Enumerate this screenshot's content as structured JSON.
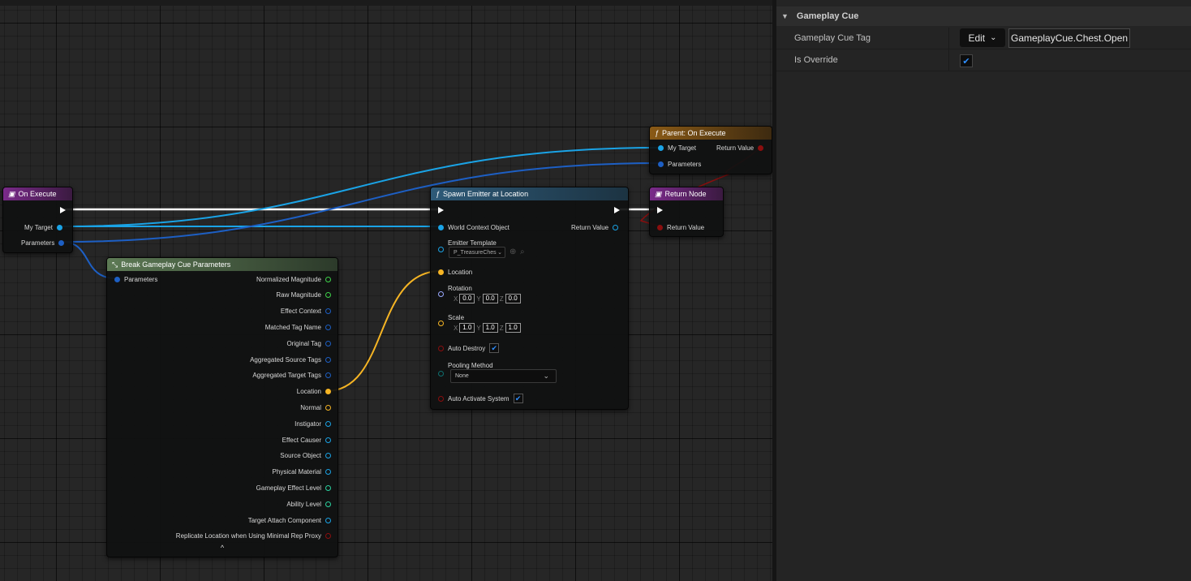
{
  "graph": {
    "nodes": {
      "on_execute": {
        "title": "On Execute",
        "pins": {
          "my_target": "My Target",
          "parameters": "Parameters"
        }
      },
      "parent_on_execute": {
        "title": "Parent: On Execute",
        "pins": {
          "my_target": "My Target",
          "parameters": "Parameters",
          "return_value": "Return Value"
        }
      },
      "spawn_emitter": {
        "title": "Spawn Emitter at Location",
        "pins": {
          "world_context": "World Context Object",
          "return_value": "Return Value",
          "emitter_template": "Emitter Template",
          "emitter_value": "P_TreasureChes",
          "location": "Location",
          "rotation": "Rotation",
          "rotation_x": "0.0",
          "rotation_y": "0.0",
          "rotation_z": "0.0",
          "scale": "Scale",
          "scale_x": "1.0",
          "scale_y": "1.0",
          "scale_z": "1.0",
          "auto_destroy": "Auto Destroy",
          "pooling_method": "Pooling Method",
          "pooling_value": "None",
          "auto_activate": "Auto Activate System",
          "axis_x": "X",
          "axis_y": "Y",
          "axis_z": "Z"
        }
      },
      "return_node": {
        "title": "Return Node",
        "pins": {
          "return_value": "Return Value"
        }
      },
      "break_params": {
        "title": "Break Gameplay Cue Parameters",
        "input": "Parameters",
        "outputs": [
          {
            "label": "Normalized Magnitude",
            "color": "#3ed24a",
            "hollow": true
          },
          {
            "label": "Raw Magnitude",
            "color": "#3ed24a",
            "hollow": true
          },
          {
            "label": "Effect Context",
            "color": "#1d5fc4",
            "hollow": true
          },
          {
            "label": "Matched Tag Name",
            "color": "#1d5fc4",
            "hollow": true
          },
          {
            "label": "Original Tag",
            "color": "#1d5fc4",
            "hollow": true
          },
          {
            "label": "Aggregated Source Tags",
            "color": "#1d5fc4",
            "hollow": true
          },
          {
            "label": "Aggregated Target Tags",
            "color": "#1d5fc4",
            "hollow": true
          },
          {
            "label": "Location",
            "color": "#f6b524",
            "hollow": false
          },
          {
            "label": "Normal",
            "color": "#f6b524",
            "hollow": true
          },
          {
            "label": "Instigator",
            "color": "#1aa3e6",
            "hollow": true
          },
          {
            "label": "Effect Causer",
            "color": "#1aa3e6",
            "hollow": true
          },
          {
            "label": "Source Object",
            "color": "#1aa3e6",
            "hollow": true
          },
          {
            "label": "Physical Material",
            "color": "#1aa3e6",
            "hollow": true
          },
          {
            "label": "Gameplay Effect Level",
            "color": "#2bd3a0",
            "hollow": true
          },
          {
            "label": "Ability Level",
            "color": "#2bd3a0",
            "hollow": true
          },
          {
            "label": "Target Attach Component",
            "color": "#1aa3e6",
            "hollow": true
          },
          {
            "label": "Replicate Location when Using Minimal Rep Proxy",
            "color": "#8b0e0e",
            "hollow": true
          }
        ],
        "collapse_glyph": "^"
      }
    }
  },
  "details": {
    "section_title": "Gameplay Cue",
    "rows": {
      "cue_tag_label": "Gameplay Cue Tag",
      "edit_button": "Edit",
      "cue_tag_value": "GameplayCue.Chest.Open",
      "override_label": "Is Override",
      "override_checked": true
    }
  },
  "colors": {
    "event_header": "#7a2a8a",
    "function_header": "#2e5a78",
    "parent_header": "#8a5a16",
    "break_header": "#5d7a55",
    "object_pin": "#1aa3e6",
    "struct_pin": "#1d5fc4",
    "vector_pin": "#f6b524",
    "bool_pin": "#8b0e0e",
    "checkbox": "#2f8fff"
  }
}
